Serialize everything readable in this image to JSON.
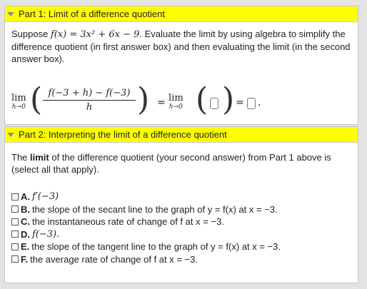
{
  "part1": {
    "header": "Part 1: Limit of a difference quotient",
    "intro_before": "Suppose ",
    "function_def": "f(x) = 3x² + 6x − 9",
    "intro_after": ". Evaluate the limit by using algebra to simplify the difference quotient (in first answer box) and then evaluating the limit (in the second answer box).",
    "equation": {
      "lim_left": "lim",
      "lim_left_sub": "h→0",
      "numerator": "f(−3 + h) − f(−3)",
      "denominator": "h",
      "equals": "=",
      "lim_right": "lim",
      "lim_right_sub": "h→0",
      "equals_2": "=",
      "trailing_period": "."
    }
  },
  "part2": {
    "header": "Part 2: Interpreting the limit of a difference quotient",
    "prompt_the": "The ",
    "prompt_bold": "limit",
    "prompt_rest": " of the difference quotient (your second answer) from Part 1 above is (select all that apply).",
    "options": [
      {
        "letter": "A.",
        "text": "f′(−3)",
        "math": true
      },
      {
        "letter": "B.",
        "text": "the slope of the secant line to the graph of y = f(x) at x = −3.",
        "math": false
      },
      {
        "letter": "C.",
        "text": "the instantaneous rate of change of f at x = −3.",
        "math": false
      },
      {
        "letter": "D.",
        "text": "f(−3).",
        "math": true
      },
      {
        "letter": "E.",
        "text": "the slope of the tangent line to the graph of y = f(x) at x = −3.",
        "math": false
      },
      {
        "letter": "F.",
        "text": "the average rate of change of f at x = −3.",
        "math": false
      }
    ]
  },
  "colors": {
    "header_bg": "#ffff00",
    "page_bg": "#e3e3e3"
  }
}
